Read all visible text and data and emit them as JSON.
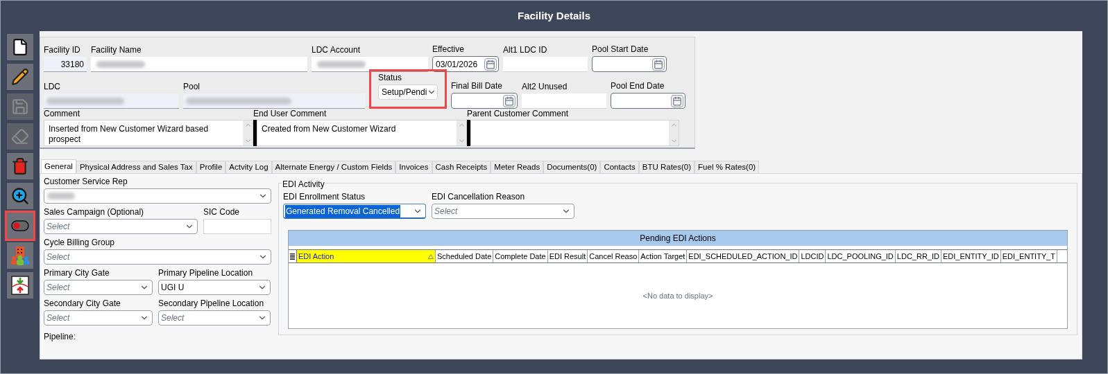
{
  "window": {
    "title": "Facility Details"
  },
  "toolbar": [
    {
      "kind": "new",
      "disabled": false,
      "highlighted": false
    },
    {
      "kind": "edit",
      "disabled": false,
      "highlighted": false
    },
    {
      "kind": "save",
      "disabled": true,
      "highlighted": false
    },
    {
      "kind": "erase",
      "disabled": true,
      "highlighted": false
    },
    {
      "kind": "delete",
      "disabled": false,
      "highlighted": false
    },
    {
      "kind": "zoom",
      "disabled": false,
      "highlighted": false
    },
    {
      "kind": "toggle",
      "disabled": false,
      "highlighted": true
    },
    {
      "kind": "people",
      "disabled": false,
      "highlighted": false
    },
    {
      "kind": "import",
      "disabled": false,
      "highlighted": false
    }
  ],
  "header": {
    "row_1": [
      {
        "kind": "readonly",
        "label": "Facility ID",
        "value": "33180"
      },
      {
        "kind": "redacted",
        "label": "Facility Name"
      },
      {
        "kind": "redacted",
        "label": "LDC Account"
      },
      {
        "kind": "date",
        "label": "Effective",
        "value": "03/01/2026"
      },
      {
        "kind": "text",
        "label": "Alt1  LDC ID"
      },
      {
        "kind": "date",
        "label": "Pool Start Date"
      }
    ],
    "row_2": [
      {
        "kind": "redacted_tinted",
        "label": "LDC"
      },
      {
        "kind": "redacted_tinted",
        "label": "Pool"
      },
      {
        "kind": "select",
        "label": "Status",
        "value": "Setup/Pendi",
        "highlighted": true
      },
      {
        "kind": "date",
        "label": "Final Bill Date"
      },
      {
        "kind": "text",
        "label": "Alt2  Unused"
      },
      {
        "kind": "date",
        "label": "Pool End Date"
      }
    ],
    "comments": [
      {
        "label": "Comment",
        "value": "Inserted from New Customer Wizard based prospect"
      },
      {
        "label": "End User Comment",
        "value": "Created from New Customer Wizard"
      },
      {
        "label": "Parent Customer Comment"
      }
    ]
  },
  "tabs": [
    {
      "label": "General",
      "selected": true
    },
    {
      "label": "Physical Address and Sales Tax",
      "selected": false
    },
    {
      "label": "Profile",
      "selected": false
    },
    {
      "label": "Actvity Log",
      "selected": false
    },
    {
      "label": "Alternate Energy / Custom Fields",
      "selected": false
    },
    {
      "label": "Invoices",
      "selected": false
    },
    {
      "label": "Cash Receipts",
      "selected": false
    },
    {
      "label": "Meter Reads",
      "selected": false
    },
    {
      "label": "Documents(0)",
      "selected": false
    },
    {
      "label": "Contacts",
      "selected": false
    },
    {
      "label": "BTU Rates(0)",
      "selected": false
    },
    {
      "label": "Fuel % Rates(0)",
      "selected": false
    }
  ],
  "general": {
    "customer_service_rep": {
      "label": "Customer Service Rep"
    },
    "sales_campaign": {
      "label": "Sales Campaign (Optional)",
      "placeholder": "Select"
    },
    "sic_code": {
      "label": "SIC Code"
    },
    "cycle_billing_group": {
      "label": "Cycle Billing Group",
      "placeholder": "Select"
    },
    "primary_city_gate": {
      "label": "Primary City Gate",
      "placeholder": "Select"
    },
    "primary_pipeline_location": {
      "label": "Primary Pipeline Location",
      "value": "UGI U"
    },
    "secondary_city_gate": {
      "label": "Secondary City Gate",
      "placeholder": "Select"
    },
    "secondary_pipeline_location": {
      "label": "Secondary Pipeline Location",
      "placeholder": "Select"
    },
    "pipeline": {
      "label": "Pipeline:"
    }
  },
  "edi_activity": {
    "title": "EDI Activity",
    "enrollment_status": {
      "label": "EDI Enrollment Status",
      "value": "Generated Removal Cancelled",
      "focused": true
    },
    "cancellation_reason": {
      "label": "EDI Cancellation Reason",
      "placeholder": "Select"
    },
    "grid": {
      "title": "Pending EDI Actions",
      "empty_text": "<No data to display>",
      "columns": [
        {
          "label": "EDI Action",
          "sorted": true
        },
        {
          "label": "Scheduled Date",
          "sorted": false
        },
        {
          "label": "Complete Date",
          "sorted": false
        },
        {
          "label": "EDI Result",
          "sorted": false
        },
        {
          "label": "Cancel Reaso",
          "sorted": false
        },
        {
          "label": "Action Target",
          "sorted": false
        },
        {
          "label": "EDI_SCHEDULED_ACTION_ID",
          "sorted": false
        },
        {
          "label": "LDCID",
          "sorted": false
        },
        {
          "label": "LDC_POOLING_ID",
          "sorted": false
        },
        {
          "label": "LDC_RR_ID",
          "sorted": false
        },
        {
          "label": "EDI_ENTITY_ID",
          "sorted": false
        },
        {
          "label": "EDI_ENTITY_T",
          "sorted": false
        }
      ]
    }
  }
}
